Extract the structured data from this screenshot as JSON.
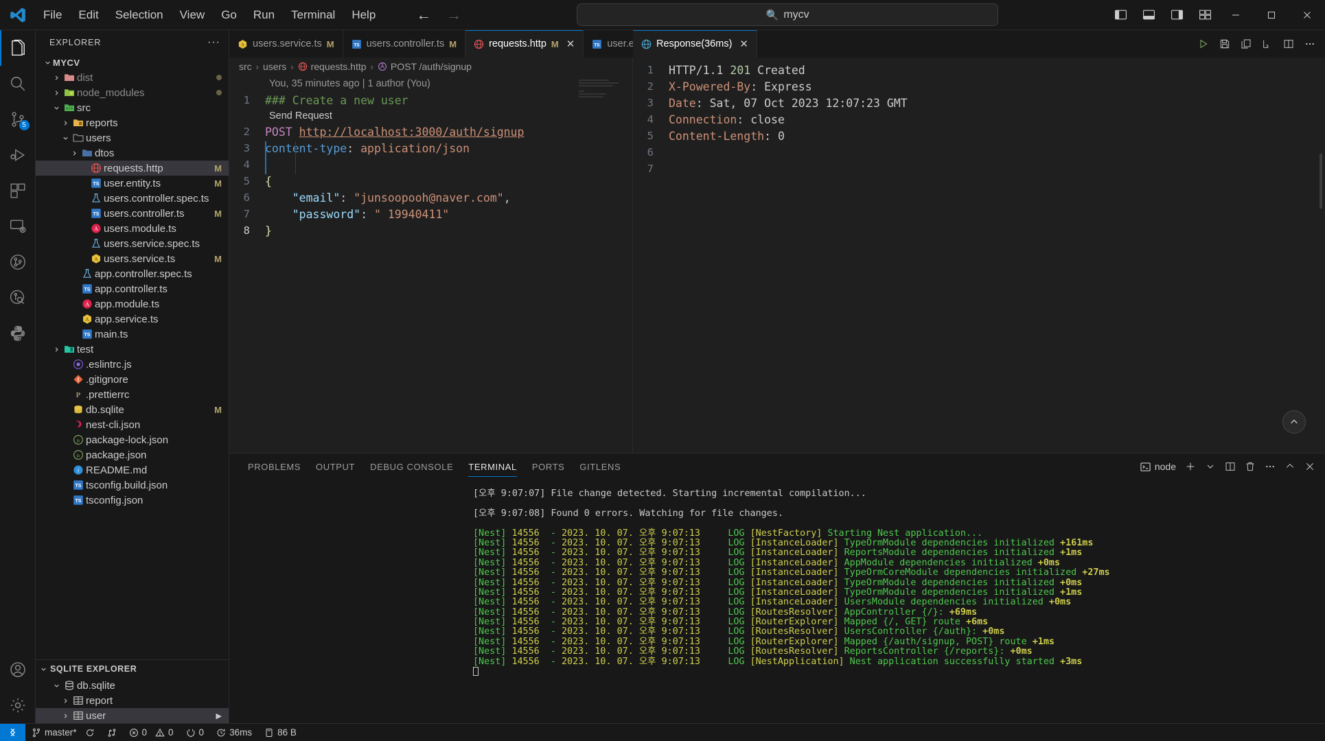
{
  "titlebar": {
    "menus": [
      "File",
      "Edit",
      "Selection",
      "View",
      "Go",
      "Run",
      "Terminal",
      "Help"
    ],
    "search_value": "mycv",
    "nav_back": "←",
    "nav_forward": "→"
  },
  "activitybar": {
    "items": [
      {
        "name": "explorer",
        "icon": "files-icon",
        "active": true,
        "badge": ""
      },
      {
        "name": "search",
        "icon": "search-icon",
        "active": false,
        "badge": ""
      },
      {
        "name": "source-control",
        "icon": "source-control-icon",
        "active": false,
        "badge": "5"
      },
      {
        "name": "run-and-debug",
        "icon": "debug-icon",
        "active": false,
        "badge": ""
      },
      {
        "name": "extensions",
        "icon": "extensions-icon",
        "active": false,
        "badge": ""
      },
      {
        "name": "remote-explorer",
        "icon": "remote-explorer-icon",
        "active": false,
        "badge": ""
      },
      {
        "name": "gitlens",
        "icon": "gitlens-icon",
        "active": false,
        "badge": ""
      },
      {
        "name": "gitlens-inspect",
        "icon": "gitlens-inspect-icon",
        "active": false,
        "badge": ""
      },
      {
        "name": "python",
        "icon": "python-icon",
        "active": false,
        "badge": ""
      }
    ],
    "bottom": [
      {
        "name": "accounts",
        "icon": "account-icon"
      },
      {
        "name": "settings",
        "icon": "gear-icon"
      }
    ]
  },
  "sidebar": {
    "title": "EXPLORER",
    "more_label": "···",
    "tree": [
      {
        "label": "MYCV",
        "depth": 0,
        "type": "root",
        "twist": "down",
        "icon": "none",
        "status": ""
      },
      {
        "label": "dist",
        "depth": 1,
        "type": "folder",
        "twist": "right",
        "icon": "folder-dist",
        "status": "dot",
        "dim": true
      },
      {
        "label": "node_modules",
        "depth": 1,
        "type": "folder",
        "twist": "right",
        "icon": "folder-node",
        "status": "dot",
        "dim": true
      },
      {
        "label": "src",
        "depth": 1,
        "type": "folder",
        "twist": "down",
        "icon": "folder-src",
        "status": ""
      },
      {
        "label": "reports",
        "depth": 2,
        "type": "folder",
        "twist": "right",
        "icon": "folder-reports",
        "status": ""
      },
      {
        "label": "users",
        "depth": 2,
        "type": "folder",
        "twist": "down",
        "icon": "folder-open",
        "status": ""
      },
      {
        "label": "dtos",
        "depth": 3,
        "type": "folder",
        "twist": "right",
        "icon": "folder-blue",
        "status": ""
      },
      {
        "label": "requests.http",
        "depth": 4,
        "type": "file",
        "twist": "none",
        "icon": "http-icon",
        "status": "M",
        "selected": true
      },
      {
        "label": "user.entity.ts",
        "depth": 4,
        "type": "file",
        "twist": "none",
        "icon": "ts-icon",
        "status": "M"
      },
      {
        "label": "users.controller.spec.ts",
        "depth": 4,
        "type": "file",
        "twist": "none",
        "icon": "test-icon",
        "status": ""
      },
      {
        "label": "users.controller.ts",
        "depth": 4,
        "type": "file",
        "twist": "none",
        "icon": "ts-icon",
        "status": "M"
      },
      {
        "label": "users.module.ts",
        "depth": 4,
        "type": "file",
        "twist": "none",
        "icon": "nest-module-icon",
        "status": ""
      },
      {
        "label": "users.service.spec.ts",
        "depth": 4,
        "type": "file",
        "twist": "none",
        "icon": "test-icon",
        "status": ""
      },
      {
        "label": "users.service.ts",
        "depth": 4,
        "type": "file",
        "twist": "none",
        "icon": "nest-service-icon",
        "status": "M"
      },
      {
        "label": "app.controller.spec.ts",
        "depth": 3,
        "type": "file",
        "twist": "none",
        "icon": "test-icon",
        "status": ""
      },
      {
        "label": "app.controller.ts",
        "depth": 3,
        "type": "file",
        "twist": "none",
        "icon": "ts-icon",
        "status": ""
      },
      {
        "label": "app.module.ts",
        "depth": 3,
        "type": "file",
        "twist": "none",
        "icon": "nest-module-icon",
        "status": ""
      },
      {
        "label": "app.service.ts",
        "depth": 3,
        "type": "file",
        "twist": "none",
        "icon": "nest-service-icon",
        "status": ""
      },
      {
        "label": "main.ts",
        "depth": 3,
        "type": "file",
        "twist": "none",
        "icon": "ts-icon",
        "status": ""
      },
      {
        "label": "test",
        "depth": 1,
        "type": "folder",
        "twist": "right",
        "icon": "folder-test",
        "status": ""
      },
      {
        "label": ".eslintrc.js",
        "depth": 2,
        "type": "file",
        "twist": "none",
        "icon": "eslint-icon",
        "status": ""
      },
      {
        "label": ".gitignore",
        "depth": 2,
        "type": "file",
        "twist": "none",
        "icon": "git-icon",
        "status": ""
      },
      {
        "label": ".prettierrc",
        "depth": 2,
        "type": "file",
        "twist": "none",
        "icon": "prettier-icon",
        "status": ""
      },
      {
        "label": "db.sqlite",
        "depth": 2,
        "type": "file",
        "twist": "none",
        "icon": "sqlite-icon",
        "status": "M"
      },
      {
        "label": "nest-cli.json",
        "depth": 2,
        "type": "file",
        "twist": "none",
        "icon": "nest-icon",
        "status": ""
      },
      {
        "label": "package-lock.json",
        "depth": 2,
        "type": "file",
        "twist": "none",
        "icon": "npm-icon",
        "status": ""
      },
      {
        "label": "package.json",
        "depth": 2,
        "type": "file",
        "twist": "none",
        "icon": "npm-icon",
        "status": ""
      },
      {
        "label": "README.md",
        "depth": 2,
        "type": "file",
        "twist": "none",
        "icon": "readme-icon",
        "status": ""
      },
      {
        "label": "tsconfig.build.json",
        "depth": 2,
        "type": "file",
        "twist": "none",
        "icon": "tsconfig-icon",
        "status": ""
      },
      {
        "label": "tsconfig.json",
        "depth": 2,
        "type": "file",
        "twist": "none",
        "icon": "tsconfig-icon",
        "status": ""
      }
    ],
    "sqlite_section": {
      "title": "SQLITE EXPLORER",
      "items": [
        {
          "label": "db.sqlite",
          "depth": 1,
          "twist": "down",
          "icon": "database-icon",
          "arrow": false
        },
        {
          "label": "report",
          "depth": 2,
          "twist": "right",
          "icon": "table-icon",
          "arrow": false
        },
        {
          "label": "user",
          "depth": 2,
          "twist": "right",
          "icon": "table-icon",
          "arrow": true,
          "selected": true
        }
      ]
    }
  },
  "editor_left": {
    "tabs": [
      {
        "label": "users.service.ts",
        "icon": "nest-service-icon",
        "modified": "M",
        "active": false,
        "closable": false
      },
      {
        "label": "users.controller.ts",
        "icon": "ts-icon",
        "modified": "M",
        "active": false,
        "closable": false
      },
      {
        "label": "requests.http",
        "icon": "http-icon",
        "modified": "M",
        "active": true,
        "closable": true
      },
      {
        "label": "user.entity.ts",
        "icon": "ts-icon",
        "modified": "M",
        "active": false,
        "closable": false
      }
    ],
    "more_label": "···",
    "breadcrumb": [
      {
        "label": "src",
        "icon": "none"
      },
      {
        "label": "users",
        "icon": "none"
      },
      {
        "label": "requests.http",
        "icon": "http-icon"
      },
      {
        "label": "POST /auth/signup",
        "icon": "symbol-icon"
      }
    ],
    "codelens": "You, 35 minutes ago | 1 author (You)",
    "send_request": "Send Request",
    "lines": [
      {
        "num": "1",
        "tokens": [
          {
            "t": "### Create a new user",
            "c": "c-comment"
          }
        ]
      },
      {
        "num": "2",
        "tokens": [
          {
            "t": "POST ",
            "c": "c-method"
          },
          {
            "t": "http://localhost:3000/auth/signup",
            "c": "c-url"
          }
        ]
      },
      {
        "num": "3",
        "tokens": [
          {
            "t": "content-type",
            "c": "c-header"
          },
          {
            "t": ": ",
            "c": "c-plain"
          },
          {
            "t": "application/json",
            "c": "c-hval"
          }
        ]
      },
      {
        "num": "4",
        "tokens": [
          {
            "t": "",
            "c": "c-plain"
          }
        ]
      },
      {
        "num": "5",
        "tokens": [
          {
            "t": "{",
            "c": "c-brace"
          }
        ]
      },
      {
        "num": "6",
        "tokens": [
          {
            "t": "    ",
            "c": "c-plain"
          },
          {
            "t": "\"email\"",
            "c": "c-key"
          },
          {
            "t": ": ",
            "c": "c-plain"
          },
          {
            "t": "\"junsoopooh@naver.com\"",
            "c": "c-str"
          },
          {
            "t": ",",
            "c": "c-plain"
          }
        ]
      },
      {
        "num": "7",
        "tokens": [
          {
            "t": "    ",
            "c": "c-plain"
          },
          {
            "t": "\"password\"",
            "c": "c-key"
          },
          {
            "t": ": ",
            "c": "c-plain"
          },
          {
            "t": "\" 19940411\"",
            "c": "c-str"
          }
        ]
      },
      {
        "num": "8",
        "tokens": [
          {
            "t": "}",
            "c": "c-brace"
          }
        ]
      }
    ]
  },
  "editor_right": {
    "tab": {
      "label": "Response(36ms)",
      "icon": "http-icon",
      "closable": true
    },
    "actions": [
      "run-icon",
      "save-icon",
      "copy-icon",
      "fold-icon",
      "split-icon",
      "more-icon"
    ],
    "lines": [
      {
        "num": "1",
        "tokens": [
          {
            "t": "HTTP/1.1 ",
            "c": "c-plain"
          },
          {
            "t": "201",
            "c": "c-num"
          },
          {
            "t": " Created",
            "c": "c-plain"
          }
        ]
      },
      {
        "num": "2",
        "tokens": [
          {
            "t": "X-Powered-By",
            "c": "c-rhead"
          },
          {
            "t": ": Express",
            "c": "c-plain"
          }
        ]
      },
      {
        "num": "3",
        "tokens": [
          {
            "t": "Date",
            "c": "c-rhead"
          },
          {
            "t": ": Sat, 07 Oct 2023 12:07:23 GMT",
            "c": "c-plain"
          }
        ]
      },
      {
        "num": "4",
        "tokens": [
          {
            "t": "Connection",
            "c": "c-rhead"
          },
          {
            "t": ": close",
            "c": "c-plain"
          }
        ]
      },
      {
        "num": "5",
        "tokens": [
          {
            "t": "Content-Length",
            "c": "c-rhead"
          },
          {
            "t": ": 0",
            "c": "c-plain"
          }
        ]
      },
      {
        "num": "6",
        "tokens": [
          {
            "t": "",
            "c": "c-plain"
          }
        ]
      },
      {
        "num": "7",
        "tokens": [
          {
            "t": "",
            "c": "c-plain"
          }
        ]
      }
    ]
  },
  "panel": {
    "tabs": [
      "PROBLEMS",
      "OUTPUT",
      "DEBUG CONSOLE",
      "TERMINAL",
      "PORTS",
      "GITLENS"
    ],
    "active_tab": "TERMINAL",
    "terminal_name": "node",
    "terminal_lines": [
      {
        "type": "plain",
        "text": "[오후 9:07:07] File change detected. Starting incremental compilation..."
      },
      {
        "type": "blank"
      },
      {
        "type": "plain",
        "text": "[오후 9:07:08] Found 0 errors. Watching for file changes."
      },
      {
        "type": "blank"
      },
      {
        "type": "nest",
        "pid": "14556",
        "date": "2023. 10. 07. 오후 9:07:13",
        "level": "LOG",
        "ctx": "[NestFactory]",
        "msg": "Starting Nest application...",
        "ms": ""
      },
      {
        "type": "nest",
        "pid": "14556",
        "date": "2023. 10. 07. 오후 9:07:13",
        "level": "LOG",
        "ctx": "[InstanceLoader]",
        "msg": "TypeOrmModule dependencies initialized",
        "ms": "+161ms"
      },
      {
        "type": "nest",
        "pid": "14556",
        "date": "2023. 10. 07. 오후 9:07:13",
        "level": "LOG",
        "ctx": "[InstanceLoader]",
        "msg": "ReportsModule dependencies initialized",
        "ms": "+1ms"
      },
      {
        "type": "nest",
        "pid": "14556",
        "date": "2023. 10. 07. 오후 9:07:13",
        "level": "LOG",
        "ctx": "[InstanceLoader]",
        "msg": "AppModule dependencies initialized",
        "ms": "+0ms"
      },
      {
        "type": "nest",
        "pid": "14556",
        "date": "2023. 10. 07. 오후 9:07:13",
        "level": "LOG",
        "ctx": "[InstanceLoader]",
        "msg": "TypeOrmCoreModule dependencies initialized",
        "ms": "+27ms"
      },
      {
        "type": "nest",
        "pid": "14556",
        "date": "2023. 10. 07. 오후 9:07:13",
        "level": "LOG",
        "ctx": "[InstanceLoader]",
        "msg": "TypeOrmModule dependencies initialized",
        "ms": "+0ms"
      },
      {
        "type": "nest",
        "pid": "14556",
        "date": "2023. 10. 07. 오후 9:07:13",
        "level": "LOG",
        "ctx": "[InstanceLoader]",
        "msg": "TypeOrmModule dependencies initialized",
        "ms": "+1ms"
      },
      {
        "type": "nest",
        "pid": "14556",
        "date": "2023. 10. 07. 오후 9:07:13",
        "level": "LOG",
        "ctx": "[InstanceLoader]",
        "msg": "UsersModule dependencies initialized",
        "ms": "+0ms"
      },
      {
        "type": "nest",
        "pid": "14556",
        "date": "2023. 10. 07. 오후 9:07:13",
        "level": "LOG",
        "ctx": "[RoutesResolver]",
        "msg": "AppController {/}:",
        "ms": "+69ms"
      },
      {
        "type": "nest",
        "pid": "14556",
        "date": "2023. 10. 07. 오후 9:07:13",
        "level": "LOG",
        "ctx": "[RouterExplorer]",
        "msg": "Mapped {/, GET} route",
        "ms": "+6ms"
      },
      {
        "type": "nest",
        "pid": "14556",
        "date": "2023. 10. 07. 오후 9:07:13",
        "level": "LOG",
        "ctx": "[RoutesResolver]",
        "msg": "UsersController {/auth}:",
        "ms": "+0ms"
      },
      {
        "type": "nest",
        "pid": "14556",
        "date": "2023. 10. 07. 오후 9:07:13",
        "level": "LOG",
        "ctx": "[RouterExplorer]",
        "msg": "Mapped {/auth/signup, POST} route",
        "ms": "+1ms"
      },
      {
        "type": "nest",
        "pid": "14556",
        "date": "2023. 10. 07. 오후 9:07:13",
        "level": "LOG",
        "ctx": "[RoutesResolver]",
        "msg": "ReportsController {/reports}:",
        "ms": "+0ms"
      },
      {
        "type": "nest",
        "pid": "14556",
        "date": "2023. 10. 07. 오후 9:07:13",
        "level": "LOG",
        "ctx": "[NestApplication]",
        "msg": "Nest application successfully started",
        "ms": "+3ms"
      }
    ]
  },
  "statusbar": {
    "remote_label": "",
    "branch": "master*",
    "errors": "0",
    "warnings": "0",
    "ports": "0",
    "time": "36ms",
    "size": "86 B"
  },
  "colors": {
    "accent": "#0078d4",
    "bg": "#1f1f1f",
    "chrome": "#181818",
    "modified": "#b2a36a",
    "selection": "#37373d"
  }
}
